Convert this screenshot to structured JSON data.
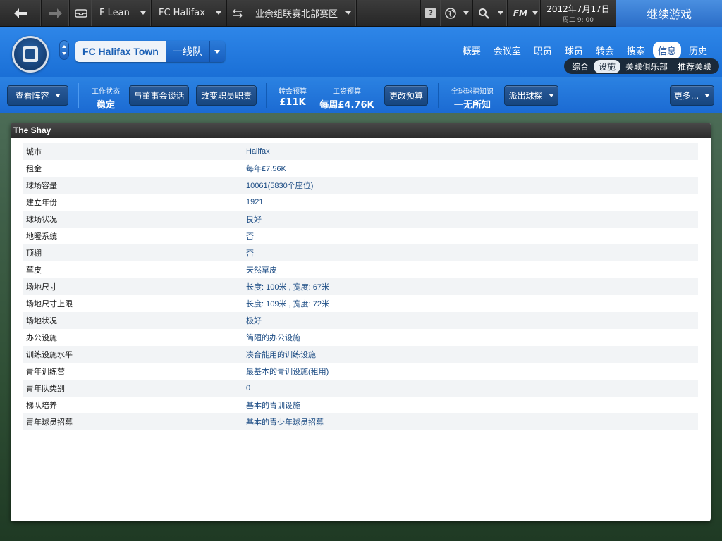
{
  "topbar": {
    "manager": "F Lean",
    "club": "FC Halifax",
    "competition": "业余组联赛北部赛区",
    "date": "2012年7月17日",
    "time": "周二 9: 00",
    "fm_label": "FM",
    "help_label": "?",
    "continue_label": "继续游戏"
  },
  "club": {
    "team_name": "FC Halifax Town",
    "squad": "一线队",
    "nav": [
      "概要",
      "会议室",
      "职员",
      "球员",
      "转会",
      "搜索",
      "信息",
      "历史"
    ],
    "nav_active": "信息",
    "subnav": [
      "综合",
      "设施",
      "关联俱乐部",
      "推荐关联"
    ],
    "subnav_active": "设施"
  },
  "actions": {
    "view_squad": "查看阵容",
    "job_status_label": "工作状态",
    "job_status_value": "稳定",
    "talk_board": "与董事会谈话",
    "change_staff": "改变职员职责",
    "transfer_budget_label": "转会预算",
    "transfer_budget_value": "£11K",
    "wage_budget_label": "工资预算",
    "wage_budget_value": "每周£4.76K",
    "change_budget": "更改预算",
    "scout_knowledge_label": "全球球探知识",
    "scout_knowledge_value": "一无所知",
    "send_scout": "派出球探",
    "more": "更多..."
  },
  "panel": {
    "title": "The Shay",
    "rows": [
      {
        "label": "城市",
        "value": "Halifax"
      },
      {
        "label": "租金",
        "value": "每年£7.56K"
      },
      {
        "label": "球场容量",
        "value": "10061(5830个座位)"
      },
      {
        "label": "建立年份",
        "value": "1921"
      },
      {
        "label": "球场状况",
        "value": "良好"
      },
      {
        "label": "地暖系统",
        "value": "否"
      },
      {
        "label": "顶棚",
        "value": "否"
      },
      {
        "label": "草皮",
        "value": "天然草皮"
      },
      {
        "label": "场地尺寸",
        "value": "长度: 100米 , 宽度: 67米"
      },
      {
        "label": "场地尺寸上限",
        "value": "长度: 109米 , 宽度: 72米"
      },
      {
        "label": "场地状况",
        "value": "极好"
      },
      {
        "label": "办公设施",
        "value": "简陋的办公设施"
      },
      {
        "label": "训练设施水平",
        "value": "凑合能用的训练设施"
      },
      {
        "label": "青年训练营",
        "value": "最基本的青训设施(租用)"
      },
      {
        "label": "青年队类别",
        "value": "0"
      },
      {
        "label": "梯队培养",
        "value": "基本的青训设施"
      },
      {
        "label": "青年球员招募",
        "value": "基本的青少年球员招募"
      }
    ]
  },
  "colors": {
    "accent_blue": "#1a6fd6",
    "continue_blue": "#2a6dc8",
    "value_text": "#1c4c84"
  }
}
